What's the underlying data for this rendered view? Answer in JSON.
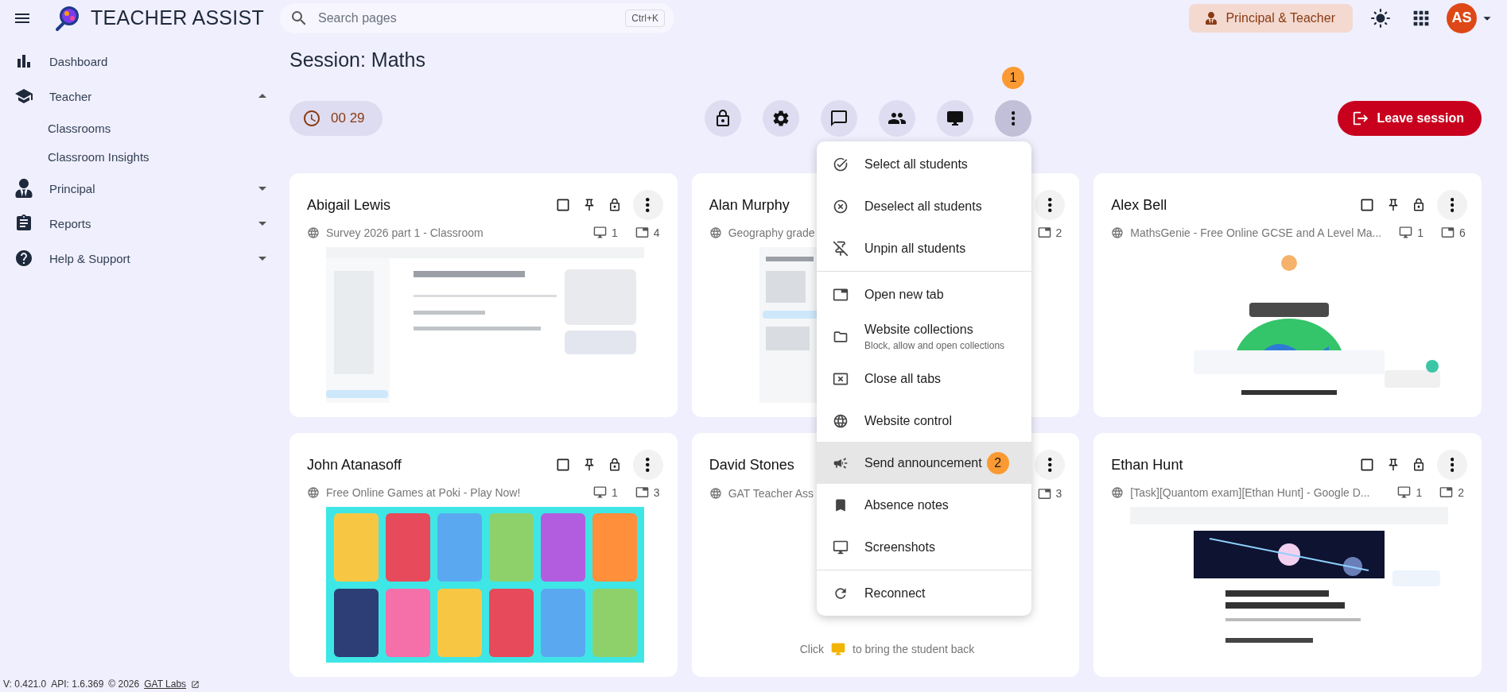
{
  "header": {
    "brand": "TEACHER ASSIST",
    "search": {
      "placeholder": "Search pages",
      "shortcut": "Ctrl+K"
    },
    "role": "Principal & Teacher",
    "avatar": "AS"
  },
  "sidebar": {
    "items": [
      {
        "label": "Dashboard"
      },
      {
        "label": "Teacher",
        "expanded": true,
        "children": [
          {
            "label": "Classrooms"
          },
          {
            "label": "Classroom Insights"
          }
        ]
      },
      {
        "label": "Principal",
        "expanded": false
      },
      {
        "label": "Reports",
        "expanded": false
      },
      {
        "label": "Help & Support",
        "expanded": false
      }
    ],
    "footer": {
      "version": "V: 0.421.0",
      "api": "API: 1.6.369",
      "copyright": "© 2026",
      "link": "GAT Labs"
    }
  },
  "session": {
    "title": "Session: Maths",
    "timer": "00 29",
    "leave": "Leave session",
    "tools": [
      {
        "active": false
      },
      {
        "active": false
      },
      {
        "active": false
      },
      {
        "active": false
      },
      {
        "active": false
      },
      {
        "active": true,
        "badge": "1"
      }
    ],
    "menu": {
      "groups": [
        [
          {
            "label": "Select all students",
            "selected": false
          },
          {
            "label": "Deselect all students",
            "selected": false
          },
          {
            "label": "Unpin all students",
            "selected": false
          }
        ],
        [
          {
            "label": "Open new tab",
            "selected": false
          },
          {
            "label": "Website collections",
            "hint": "Block, allow and open collections",
            "selected": false
          },
          {
            "label": "Close all tabs",
            "selected": false
          },
          {
            "label": "Website control",
            "selected": false
          },
          {
            "label": "Send announcement",
            "selected": true,
            "badge": "2"
          },
          {
            "label": "Absence notes",
            "selected": false
          },
          {
            "label": "Screenshots",
            "selected": false
          }
        ],
        [
          {
            "label": "Reconnect",
            "selected": false
          }
        ]
      ]
    }
  },
  "students": [
    {
      "name": "Abigail Lewis",
      "checked": false,
      "page": "Survey 2026 part 1 - Classroom",
      "screens": "1",
      "tabs": "4"
    },
    {
      "name": "Alan Murphy",
      "page": "Geography grade",
      "tabs": "2"
    },
    {
      "name": "Alex Bell",
      "checked": false,
      "page": "MathsGenie - Free Online GCSE and A Level Ma...",
      "screens": "1",
      "tabs": "6"
    },
    {
      "name": "John Atanasoff",
      "checked": false,
      "page": "Free Online Games at Poki - Play Now!",
      "screens": "1",
      "tabs": "3"
    },
    {
      "name": "David Stones",
      "page": "GAT Teacher Ass",
      "tabs": "3",
      "body": {
        "kind": "offline",
        "before": "Click",
        "after": "to bring the student back"
      }
    },
    {
      "name": "Ethan Hunt",
      "checked": false,
      "page": "[Task][Quantom exam][Ethan Hunt] - Google D...",
      "screens": "1",
      "tabs": "2"
    }
  ]
}
